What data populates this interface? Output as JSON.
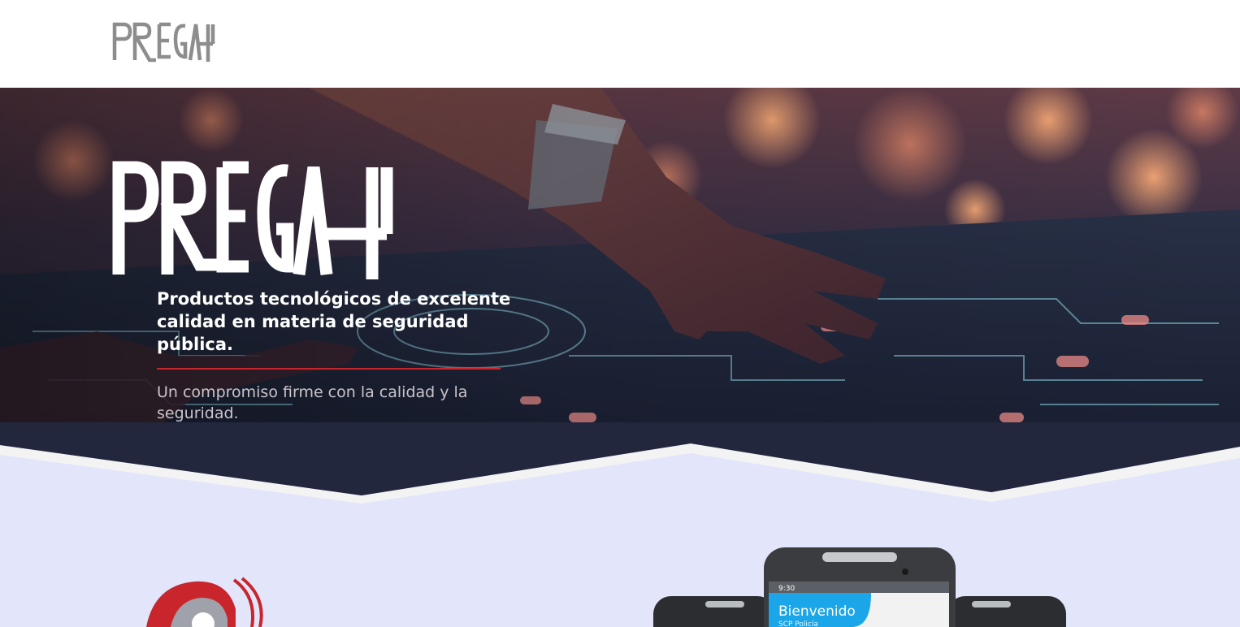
{
  "header": {
    "logo_text": "PREGAT"
  },
  "hero": {
    "logo_text": "PREGAT",
    "title": "Productos tecnológicos de excelente calidad en materia de seguridad pública.",
    "subtitle": "Un compromiso firme con la calidad y la seguridad."
  },
  "phone_screen": {
    "time": "9:30",
    "welcome": "Bienvenido",
    "app_name": "SCP Policía"
  },
  "colors": {
    "accent_red": "#c8262c",
    "logo_gray": "#8d8d8d",
    "band_lavender": "#e3e6fb",
    "phone_blue": "#1aa6e8"
  }
}
